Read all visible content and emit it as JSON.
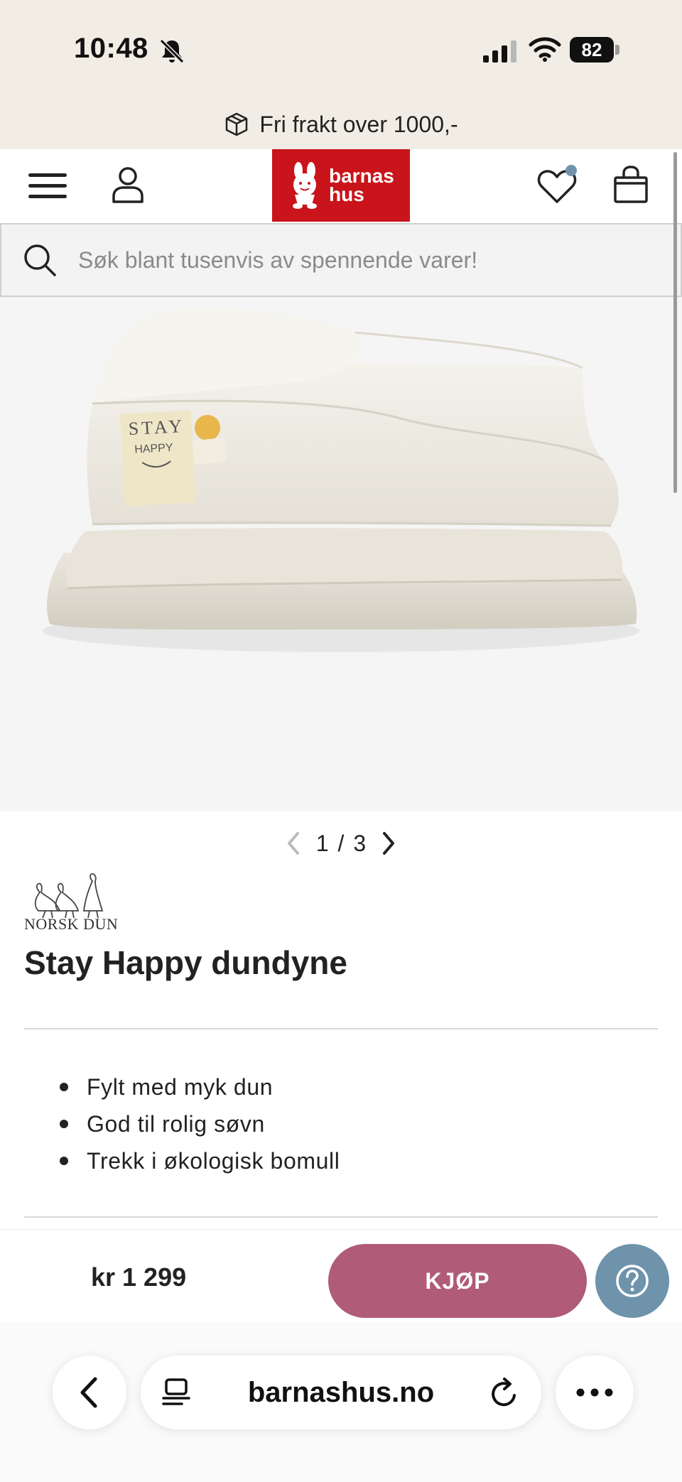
{
  "status_bar": {
    "time": "10:48",
    "battery": "82"
  },
  "banner": {
    "shipping_text": "Fri frakt over 1000,-"
  },
  "header": {
    "logo_line1": "barnas",
    "logo_line2": "hus",
    "brand_color": "#c8141a"
  },
  "search": {
    "placeholder": "Søk blant tusenvis av spennende varer!"
  },
  "gallery": {
    "current": 1,
    "total": 3,
    "indicator": "1 / 3"
  },
  "product": {
    "brand": "NORSK DUN",
    "title": "Stay Happy dundyne",
    "label_line1": "STAY",
    "label_line2": "HAPPY",
    "features": [
      "Fylt med myk dun",
      "God til rolig søvn",
      "Trekk i økologisk bomull"
    ],
    "price": "kr 1 299"
  },
  "actions": {
    "buy_label": "KJØP",
    "buy_color": "#b05b78",
    "help_color": "#6e93ab"
  },
  "browser": {
    "url": "barnashus.no"
  }
}
